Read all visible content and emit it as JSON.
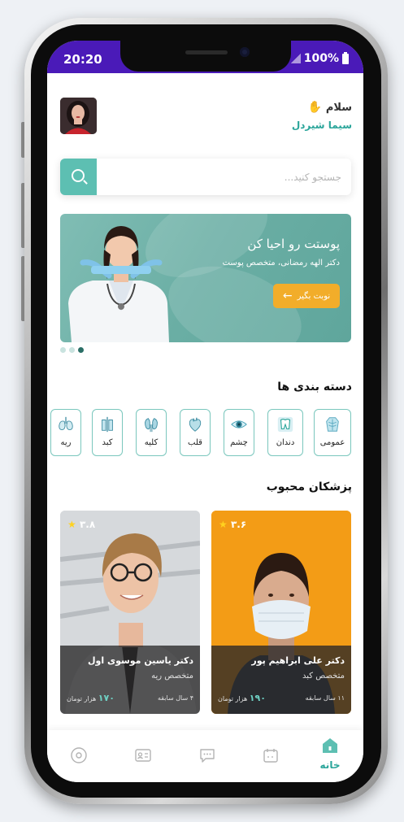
{
  "status_bar": {
    "time": "20:20",
    "battery": "100%"
  },
  "header": {
    "greeting": "سلام",
    "user_name": "سیما شیردل"
  },
  "search": {
    "placeholder": "جستجو کنید..."
  },
  "banner": {
    "title": "پوستت رو احیا کن",
    "subtitle": "دکتر الهه رمضانی، متخصص پوست",
    "button_label": "نوبت بگیر",
    "slides": 3,
    "active_slide": 3
  },
  "categories": {
    "title": "دسته بندی ها",
    "items": [
      {
        "label": "عمومی",
        "icon": "body-icon"
      },
      {
        "label": "دندان",
        "icon": "tooth-icon"
      },
      {
        "label": "چشم",
        "icon": "eye-icon"
      },
      {
        "label": "قلب",
        "icon": "heart-icon"
      },
      {
        "label": "کلیه",
        "icon": "kidney-icon"
      },
      {
        "label": "کبد",
        "icon": "liver-icon"
      },
      {
        "label": "ریه",
        "icon": "lung-icon"
      }
    ]
  },
  "doctors": {
    "title": "پزشکان محبوب",
    "items": [
      {
        "name": "دکتر علی ابراهیم پور",
        "specialty": "متخصص کبد",
        "experience": "۱۱ سال سابقه",
        "price_value": "۱۹۰",
        "price_unit": "هزار تومان",
        "rating": "۳.۶"
      },
      {
        "name": "دکتر یاسین موسوی اول",
        "specialty": "متخصص ریه",
        "experience": "۴ سال سابقه",
        "price_value": "۱۷۰",
        "price_unit": "هزار تومان",
        "rating": "۳.۸"
      }
    ]
  },
  "tab_bar": {
    "home_label": "خانه"
  },
  "colors": {
    "primary": "#5dbfb2",
    "accent": "#f2ad2a",
    "status_bar": "#4a1ab8"
  }
}
